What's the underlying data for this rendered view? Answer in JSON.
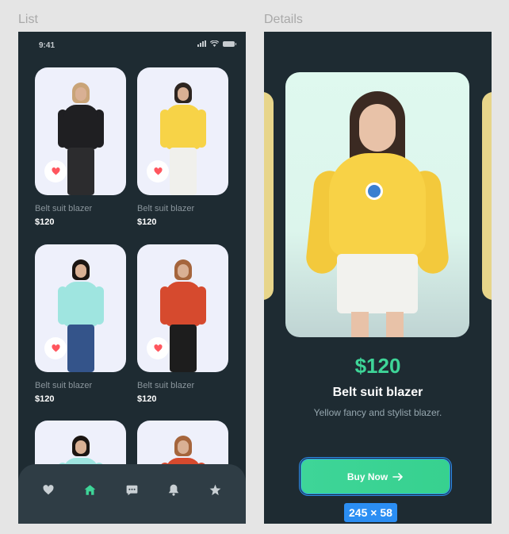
{
  "frames": {
    "list_title": "List",
    "details_title": "Details"
  },
  "status": {
    "time": "9:41",
    "icons": [
      "signal-icon",
      "wifi-icon",
      "battery-icon"
    ]
  },
  "products": [
    {
      "name": "Belt suit blazer",
      "price": "$120",
      "look": {
        "hair": "#c9a478",
        "top": "#1f1f22",
        "bottom": "#2c2c2e"
      }
    },
    {
      "name": "Belt suit blazer",
      "price": "$120",
      "look": {
        "hair": "#2d2520",
        "top": "#f7d347",
        "bottom": "#f0f0ec"
      }
    },
    {
      "name": "Belt suit blazer",
      "price": "$120",
      "look": {
        "hair": "#1b1512",
        "top": "#9fe5e0",
        "bottom": "#34548a"
      }
    },
    {
      "name": "Belt suit blazer",
      "price": "$120",
      "look": {
        "hair": "#a5653c",
        "top": "#d64a2e",
        "bottom": "#1d1d1d"
      }
    },
    {
      "name": "",
      "price": "",
      "look": {
        "hair": "#1b1512",
        "top": "#9fe5e0",
        "bottom": "#34548a"
      }
    },
    {
      "name": "",
      "price": "",
      "look": {
        "hair": "#a5653c",
        "top": "#d64a2e",
        "bottom": "#1d1d1d"
      }
    }
  ],
  "tabbar": [
    {
      "icon": "heart-icon",
      "active": false
    },
    {
      "icon": "home-icon",
      "active": true
    },
    {
      "icon": "chat-icon",
      "active": false
    },
    {
      "icon": "bell-icon",
      "active": false
    },
    {
      "icon": "star-icon",
      "active": false
    }
  ],
  "details": {
    "price": "$120",
    "name": "Belt suit blazer",
    "description": "Yellow fancy and stylist blazer.",
    "buy_label": "Buy Now",
    "button_icon": "arrow-right-icon"
  },
  "size_tag": "245 × 58",
  "colors": {
    "background": "#1e2b32",
    "accent": "#3ed598",
    "selection": "#2b8ef3",
    "favorite": "#ff565e"
  }
}
